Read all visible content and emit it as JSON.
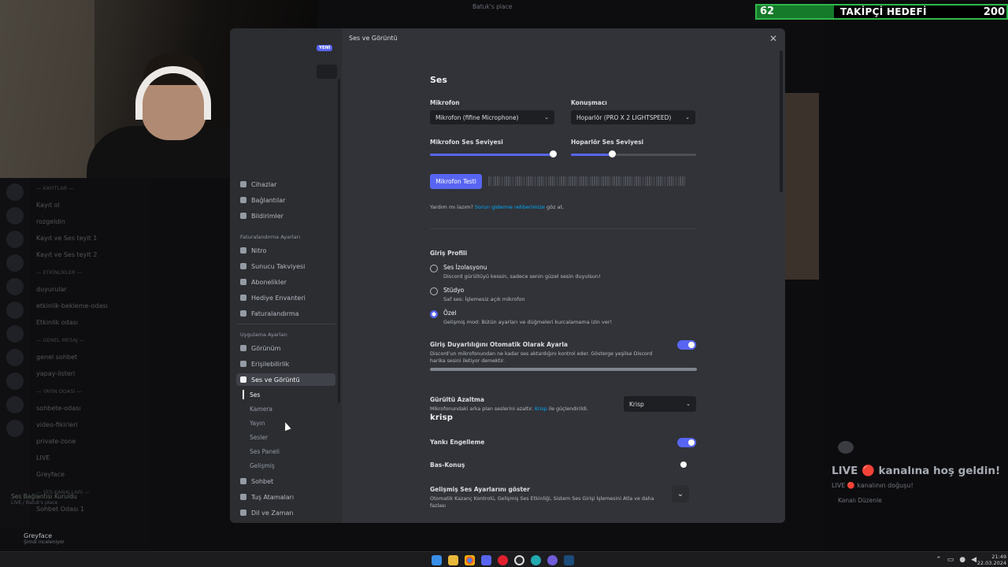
{
  "background": {
    "window_title": "Batuk's place",
    "channels": [
      {
        "text": "— KAYITLAR —",
        "header": true
      },
      {
        "text": "Kayıt ol"
      },
      {
        "text": "rozgeldin"
      },
      {
        "text": "Kayıt ve Ses teyit 1"
      },
      {
        "text": "Kayıt ve Ses teyit 2"
      },
      {
        "text": "— ETKİNLİKLER —",
        "header": true
      },
      {
        "text": "duyurular"
      },
      {
        "text": "etkinlik-bekleme-odası"
      },
      {
        "text": "Etkinlik odası"
      },
      {
        "text": "— GENEL MESAJ —",
        "header": true
      },
      {
        "text": "genel sohbet"
      },
      {
        "text": "yapay-listeri"
      },
      {
        "text": "— YAYIN ODASI —",
        "header": true
      },
      {
        "text": "sohbete-odası"
      },
      {
        "text": "video-fikirleri"
      },
      {
        "text": "private-zone"
      },
      {
        "text": "LIVE"
      },
      {
        "text": "Greyface"
      },
      {
        "text": "— SES KANALLARI —",
        "header": true
      },
      {
        "text": "Sohbet Odası 1"
      }
    ],
    "voice_status": "Ses Bağlantısı Kuruldu",
    "voice_sub": "LIVE / Batuk's place",
    "user_name": "Greyface",
    "user_status": "Şimdi inceleniyor",
    "goal": {
      "current": "62",
      "label": "TAKİPÇİ HEDEFİ",
      "target": "200"
    },
    "live_panel": {
      "title": "LIVE 🔴 kanalına hoş geldin!",
      "sub": "LIVE 🔴 kanalının doğuşu!",
      "link": "Kanalı Düzenle"
    },
    "clock": {
      "time": "21:49",
      "date": "22.03.2024"
    }
  },
  "modal": {
    "title": "Ses ve Görüntü",
    "close_icon": "close-icon",
    "new_badge": "YENİ",
    "nav_top": [
      {
        "label": "Cihazlar",
        "icon": "device-icon"
      },
      {
        "label": "Bağlantılar",
        "icon": "link-icon"
      },
      {
        "label": "Bildirimler",
        "icon": "bell-icon"
      }
    ],
    "billing_header": "Faturalandırma Ayarları",
    "nav_billing": [
      {
        "label": "Nitro",
        "icon": "nitro-icon"
      },
      {
        "label": "Sunucu Takviyesi",
        "icon": "boost-icon"
      },
      {
        "label": "Abonelikler",
        "icon": "subscription-icon"
      },
      {
        "label": "Hediye Envanteri",
        "icon": "gift-icon"
      },
      {
        "label": "Faturalandırma",
        "icon": "billing-icon"
      }
    ],
    "app_header": "Uygulama Ayarları",
    "nav_app": [
      {
        "label": "Görünüm",
        "icon": "palette-icon"
      },
      {
        "label": "Erişilebilirlik",
        "icon": "accessibility-icon"
      },
      {
        "label": "Ses ve Görüntü",
        "icon": "microphone-icon",
        "active": true
      }
    ],
    "sub_items": [
      "Ses",
      "Kamera",
      "Yayın",
      "Sesler",
      "Ses Paneli",
      "Gelişmiş"
    ],
    "nav_bottom": [
      {
        "label": "Sohbet",
        "icon": "chat-icon"
      },
      {
        "label": "Tuş Atamaları",
        "icon": "keyboard-icon"
      },
      {
        "label": "Dil ve Zaman",
        "icon": "language-icon"
      }
    ]
  },
  "voice": {
    "section_title": "Ses",
    "mic_label": "Mikrofon",
    "mic_value": "Mikrofon (fifine Microphone)",
    "speaker_label": "Konuşmacı",
    "speaker_value": "Hoparlör (PRO X 2 LIGHTSPEED)",
    "mic_volume_label": "Mikrofon Ses Seviyesi",
    "mic_volume": 0.98,
    "speaker_volume_label": "Hoparlör Ses Seviyesi",
    "speaker_volume": 0.33,
    "mic_test_button": "Mikrofon Testi",
    "help_prefix": "Yardım mı lazım?",
    "help_link": "Sorun giderme rehberimize",
    "help_suffix": "göz at.",
    "input_profile_title": "Giriş Profili",
    "profiles": [
      {
        "title": "Ses İzolasyonu",
        "desc": "Discord gürültüyü kessin, sadece senin güzel sesin duyulsun!",
        "selected": false
      },
      {
        "title": "Stüdyo",
        "desc": "Saf ses: İşlemesiz açık mikrofon",
        "selected": false
      },
      {
        "title": "Özel",
        "desc": "Gelişmiş mod: Bütün ayarları ve düğmeleri kurcalamama izin ver!",
        "selected": true
      }
    ],
    "auto_sens_title": "Giriş Duyarlılığını Otomatik Olarak Ayarla",
    "auto_sens_desc": "Discord'un mikrofonundan ne kadar ses aktardığını kontrol eder. Gösterge yeşilse Discord harika sesini iletiyor demektir.",
    "auto_sens_on": true,
    "noise_title": "Gürültü Azaltma",
    "noise_desc_prefix": "Mikrofonundaki arka plan seslerini azaltır.",
    "noise_desc_link": "Krisp",
    "noise_desc_suffix": "ile güçlendirildi.",
    "krisp_logo": "krisp",
    "noise_value": "Krisp",
    "echo_title": "Yankı Engelleme",
    "echo_on": true,
    "ptt_title": "Bas-Konuş",
    "ptt_on": false,
    "advanced_title": "Gelişmiş Ses Ayarlarını göster",
    "advanced_desc": "Otomatik Kazanç Kontrolü, Gelişmiş Ses Etkinliği, Sistem Ses Girişi İşlemesini Atla ve daha fazlası"
  }
}
